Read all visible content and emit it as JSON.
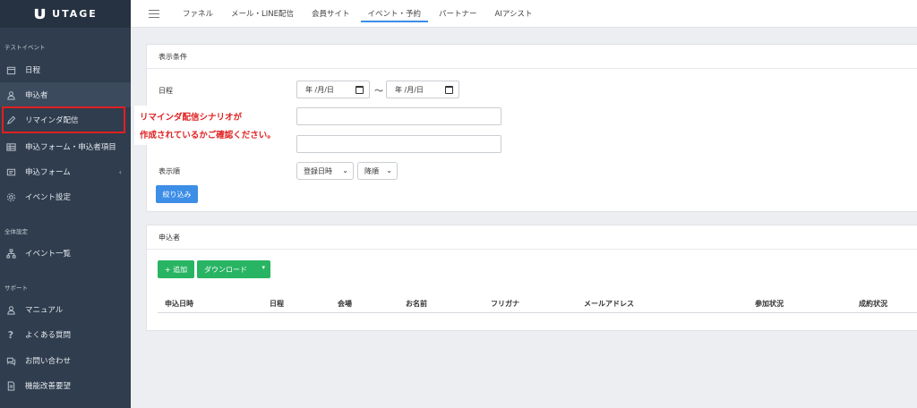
{
  "logo": {
    "text": "UTAGE"
  },
  "sidebar": {
    "sections": [
      {
        "label": "テストイベント"
      },
      {
        "label": "全体設定"
      },
      {
        "label": "サポート"
      }
    ],
    "items": [
      {
        "label": "日程",
        "icon": "calendar-icon"
      },
      {
        "label": "申込者",
        "icon": "user-icon"
      },
      {
        "label": "リマインダ配信",
        "icon": "pencil-icon"
      },
      {
        "label": "申込フォーム・申込者項目",
        "icon": "table-icon"
      },
      {
        "label": "申込フォーム",
        "icon": "form-icon"
      },
      {
        "label": "イベント設定",
        "icon": "gear-icon"
      },
      {
        "label": "イベント一覧",
        "icon": "sitemap-icon"
      },
      {
        "label": "マニュアル",
        "icon": "user-icon"
      },
      {
        "label": "よくある質問",
        "icon": "question-icon"
      },
      {
        "label": "お問い合わせ",
        "icon": "chat-icon"
      },
      {
        "label": "機能改善要望",
        "icon": "document-icon"
      }
    ],
    "chevron": "‹"
  },
  "nav": {
    "tabs": [
      "ファネル",
      "メール・LINE配信",
      "会員サイト",
      "イベント・予約",
      "パートナー",
      "AIアシスト"
    ],
    "active_index": 3
  },
  "filter": {
    "title": "表示条件",
    "date_label": "日程",
    "date_from_placeholder": "年 /月/日",
    "date_to_placeholder": "年 /月/日",
    "tilde": "〜",
    "sort_label": "表示順",
    "sort_field": "登録日時",
    "sort_order": "降順",
    "submit_label": "絞り込み"
  },
  "applicants": {
    "title": "申込者",
    "add_label": "+ 追加",
    "download_label": "ダウンロード",
    "columns": [
      "申込日時",
      "日程",
      "会場",
      "お名前",
      "フリガナ",
      "メールアドレス",
      "参加状況",
      "成約状況"
    ]
  },
  "callout": {
    "line1": "リマインダ配信シナリオが",
    "line2": "作成されているかご確認ください。"
  },
  "colors": {
    "sidebar_bg": "#2f3d4e",
    "accent_blue": "#3d8ee6",
    "button_green": "#28b463",
    "highlight_red": "#e02020"
  }
}
